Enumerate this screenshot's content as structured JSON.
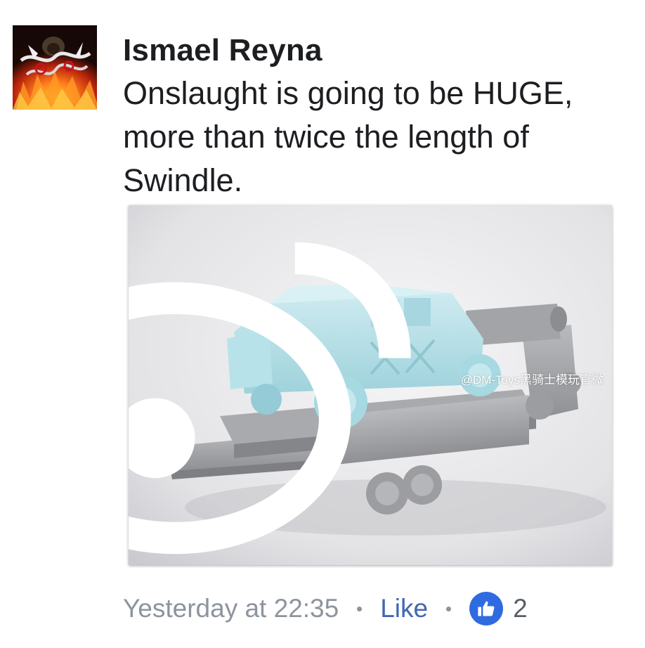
{
  "post": {
    "author": "Ismael Reyna",
    "message": "Onslaught is going to be HUGE, more than twice the length of Swindle.",
    "photo": {
      "watermark": "@DM-Toys黑骑士模玩官微"
    }
  },
  "footer": {
    "timestamp": "Yesterday at 22:35",
    "like_label": "Like",
    "like_count": "2"
  },
  "icons": {
    "like_reaction": "thumbs-up-icon",
    "watermark_logo": "weibo-icon"
  },
  "colors": {
    "author_text": "#1c1e21",
    "meta_text": "#8d949e",
    "link_blue": "#4267b2",
    "reaction_blue": "#2f6be0"
  }
}
